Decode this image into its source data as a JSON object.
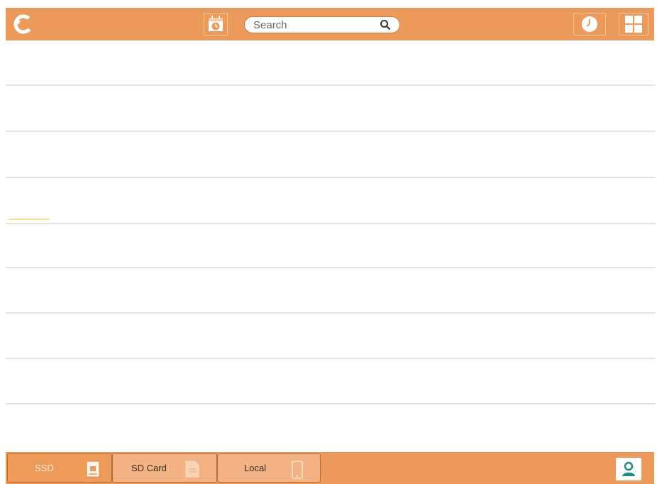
{
  "topbar": {
    "search": {
      "placeholder": "Search",
      "value": ""
    },
    "icons": {
      "back": "back-arrow-icon",
      "calendar": "calendar-clock-icon",
      "search": "magnifier-icon",
      "history": "clock-icon",
      "grid": "grid-view-icon"
    }
  },
  "list": {
    "rows": 8
  },
  "bottombar": {
    "tabs": [
      {
        "label": "SSD",
        "icon": "ssd-drive-icon",
        "active": true
      },
      {
        "label": "SD Card",
        "icon": "sd-card-icon",
        "active": false
      },
      {
        "label": "Local",
        "icon": "phone-icon",
        "active": false
      }
    ],
    "account_icon": "user-account-icon"
  },
  "colors": {
    "bar": "#ec9a5c",
    "active_tab": "#ee9a58",
    "inactive_tab": "#f3b283",
    "divider": "#e2e2e2"
  }
}
